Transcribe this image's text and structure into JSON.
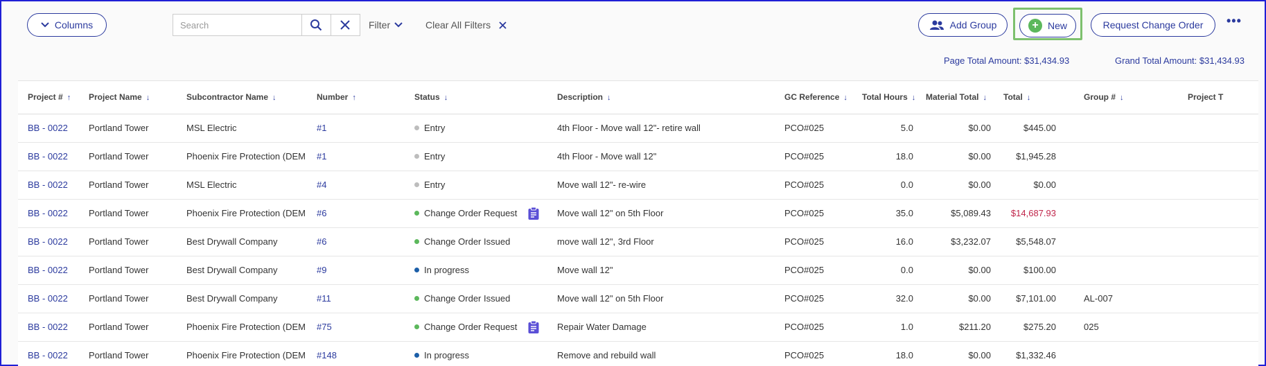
{
  "toolbar": {
    "columns_label": "Columns",
    "search_placeholder": "Search",
    "filter_label": "Filter",
    "clear_filters_label": "Clear All Filters",
    "add_group_label": "Add Group",
    "new_label": "New",
    "request_change_order_label": "Request Change Order",
    "more_label": "•••"
  },
  "totals": {
    "page_total": "Page Total Amount: $31,434.93",
    "grand_total": "Grand Total Amount: $31,434.93"
  },
  "table": {
    "headers": [
      "Project #",
      "Project Name",
      "Subcontractor Name",
      "Number",
      "Status",
      "Description",
      "GC Reference",
      "Total Hours",
      "Material Total",
      "Total",
      "Group #",
      "Project T"
    ],
    "header_arrows": [
      "↑",
      "↓",
      "↓",
      "↑",
      "↓",
      "↓",
      "↓",
      "↓",
      "↓",
      "↓",
      "↓",
      ""
    ],
    "rows": [
      {
        "project": "BB - 0022",
        "project_name": "Portland Tower",
        "subcontractor": "MSL Electric",
        "number": "#1",
        "status": "Entry",
        "status_kind": "entry",
        "clip": false,
        "description": "4th Floor - Move wall 12\"- retire wall",
        "gc_ref": "PCO#025",
        "hours": "5.0",
        "material": "$0.00",
        "total": "$445.00",
        "total_neg": false,
        "group": ""
      },
      {
        "project": "BB - 0022",
        "project_name": "Portland Tower",
        "subcontractor": "Phoenix Fire Protection (DEM",
        "number": "#1",
        "status": "Entry",
        "status_kind": "entry",
        "clip": false,
        "description": "4th Floor - Move wall 12\"",
        "gc_ref": "PCO#025",
        "hours": "18.0",
        "material": "$0.00",
        "total": "$1,945.28",
        "total_neg": false,
        "group": ""
      },
      {
        "project": "BB - 0022",
        "project_name": "Portland Tower",
        "subcontractor": "MSL Electric",
        "number": "#4",
        "status": "Entry",
        "status_kind": "entry",
        "clip": false,
        "description": "Move wall 12\"- re-wire",
        "gc_ref": "PCO#025",
        "hours": "0.0",
        "material": "$0.00",
        "total": "$0.00",
        "total_neg": false,
        "group": ""
      },
      {
        "project": "BB - 0022",
        "project_name": "Portland Tower",
        "subcontractor": "Phoenix Fire Protection (DEM",
        "number": "#6",
        "status": "Change Order Request",
        "status_kind": "green",
        "clip": true,
        "description": "Move wall 12\" on 5th Floor",
        "gc_ref": "PCO#025",
        "hours": "35.0",
        "material": "$5,089.43",
        "total": "$14,687.93",
        "total_neg": true,
        "group": ""
      },
      {
        "project": "BB - 0022",
        "project_name": "Portland Tower",
        "subcontractor": "Best Drywall Company",
        "number": "#6",
        "status": "Change Order Issued",
        "status_kind": "green",
        "clip": false,
        "description": "move wall 12\", 3rd Floor",
        "gc_ref": "PCO#025",
        "hours": "16.0",
        "material": "$3,232.07",
        "total": "$5,548.07",
        "total_neg": false,
        "group": ""
      },
      {
        "project": "BB - 0022",
        "project_name": "Portland Tower",
        "subcontractor": "Best Drywall Company",
        "number": "#9",
        "status": "In progress",
        "status_kind": "blue",
        "clip": false,
        "description": "Move wall 12\"",
        "gc_ref": "PCO#025",
        "hours": "0.0",
        "material": "$0.00",
        "total": "$100.00",
        "total_neg": false,
        "group": ""
      },
      {
        "project": "BB - 0022",
        "project_name": "Portland Tower",
        "subcontractor": "Best Drywall Company",
        "number": "#11",
        "status": "Change Order Issued",
        "status_kind": "green",
        "clip": false,
        "description": "Move wall 12\" on 5th Floor",
        "gc_ref": "PCO#025",
        "hours": "32.0",
        "material": "$0.00",
        "total": "$7,101.00",
        "total_neg": false,
        "group": "AL-007"
      },
      {
        "project": "BB - 0022",
        "project_name": "Portland Tower",
        "subcontractor": "Phoenix Fire Protection (DEM",
        "number": "#75",
        "status": "Change Order Request",
        "status_kind": "green",
        "clip": true,
        "description": "Repair Water Damage",
        "gc_ref": "PCO#025",
        "hours": "1.0",
        "material": "$211.20",
        "total": "$275.20",
        "total_neg": false,
        "group": "025"
      },
      {
        "project": "BB - 0022",
        "project_name": "Portland Tower",
        "subcontractor": "Phoenix Fire Protection (DEM",
        "number": "#148",
        "status": "In progress",
        "status_kind": "blue",
        "clip": false,
        "description": "Remove and rebuild wall",
        "gc_ref": "PCO#025",
        "hours": "18.0",
        "material": "$0.00",
        "total": "$1,332.46",
        "total_neg": false,
        "group": ""
      }
    ]
  },
  "colors": {
    "accent": "#2b3a9e",
    "highlight_border": "#7dc06d",
    "negative": "#c0254a",
    "status_green": "#5cb85c",
    "status_blue": "#1c5fa8",
    "status_entry": "#bdbdbd"
  },
  "icons": {
    "columns": "chevron-down-icon",
    "search": "search-icon",
    "clear": "close-icon",
    "add_group": "users-icon",
    "new": "plus-circle-icon",
    "attachment": "clipboard-icon"
  }
}
